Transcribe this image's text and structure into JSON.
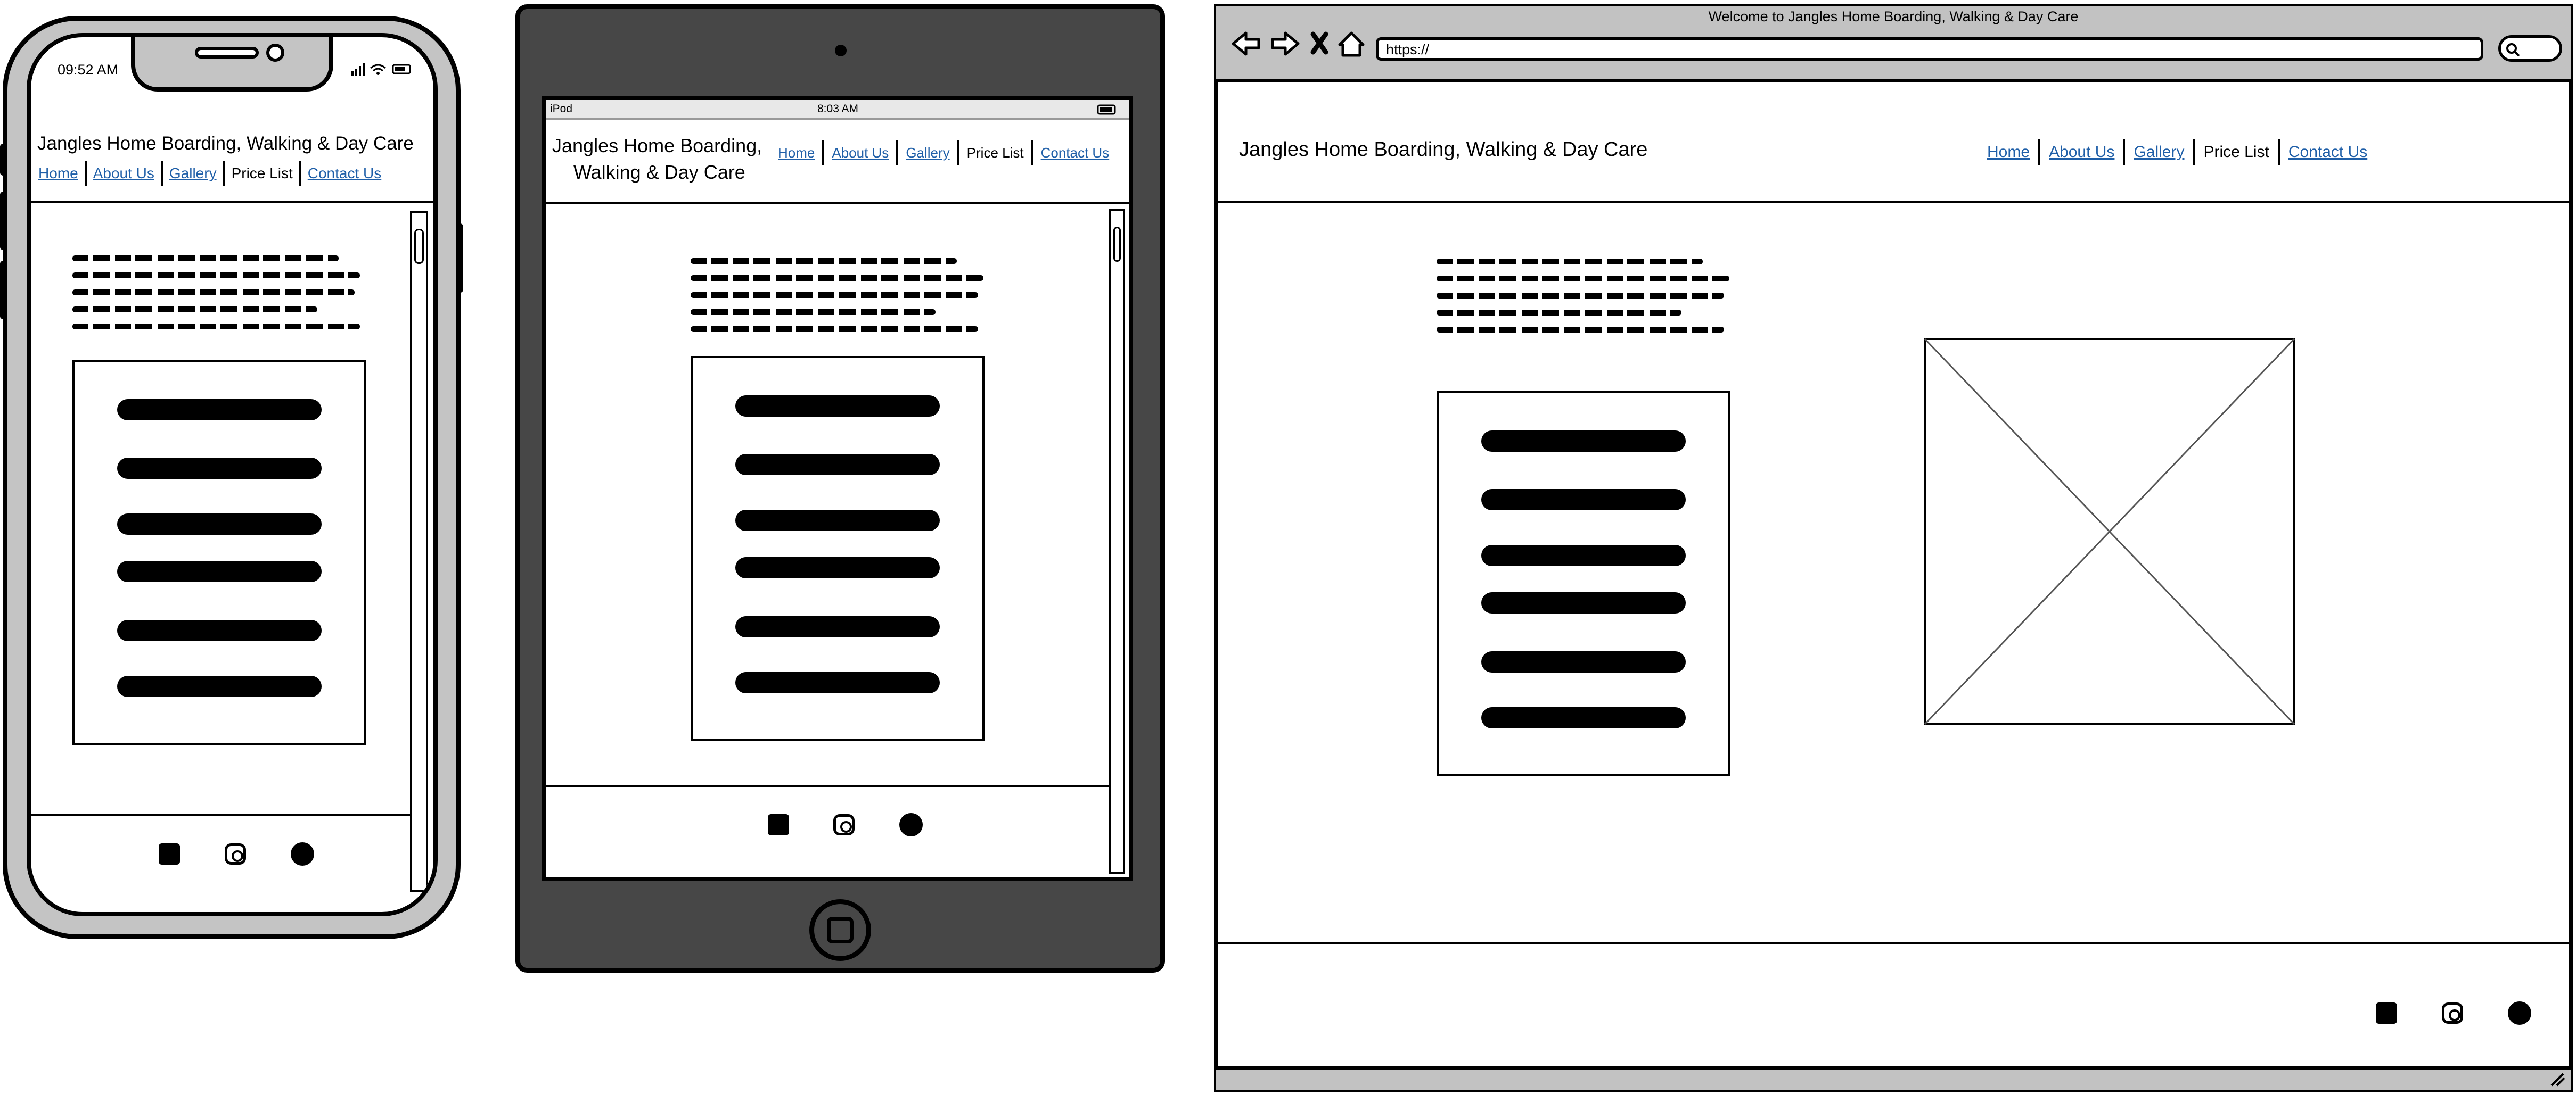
{
  "site": {
    "title": "Jangles Home Boarding, Walking & Day Care",
    "title_line1": "Jangles Home Boarding,",
    "title_line2": "Walking & Day Care",
    "nav": [
      "Home",
      "About Us",
      "Gallery",
      "Price List",
      "Contact Us"
    ],
    "active_nav": "Price List"
  },
  "phone": {
    "time": "09:52 AM"
  },
  "tablet": {
    "device": "iPod",
    "time": "8:03 AM"
  },
  "browser": {
    "window_title": "Welcome to Jangles Home Boarding, Walking & Day Care",
    "url": "https://"
  },
  "icons": [
    "facebook-icon",
    "instagram-icon",
    "clock-icon",
    "back-icon",
    "forward-icon",
    "close-icon",
    "home-icon",
    "search-icon"
  ]
}
